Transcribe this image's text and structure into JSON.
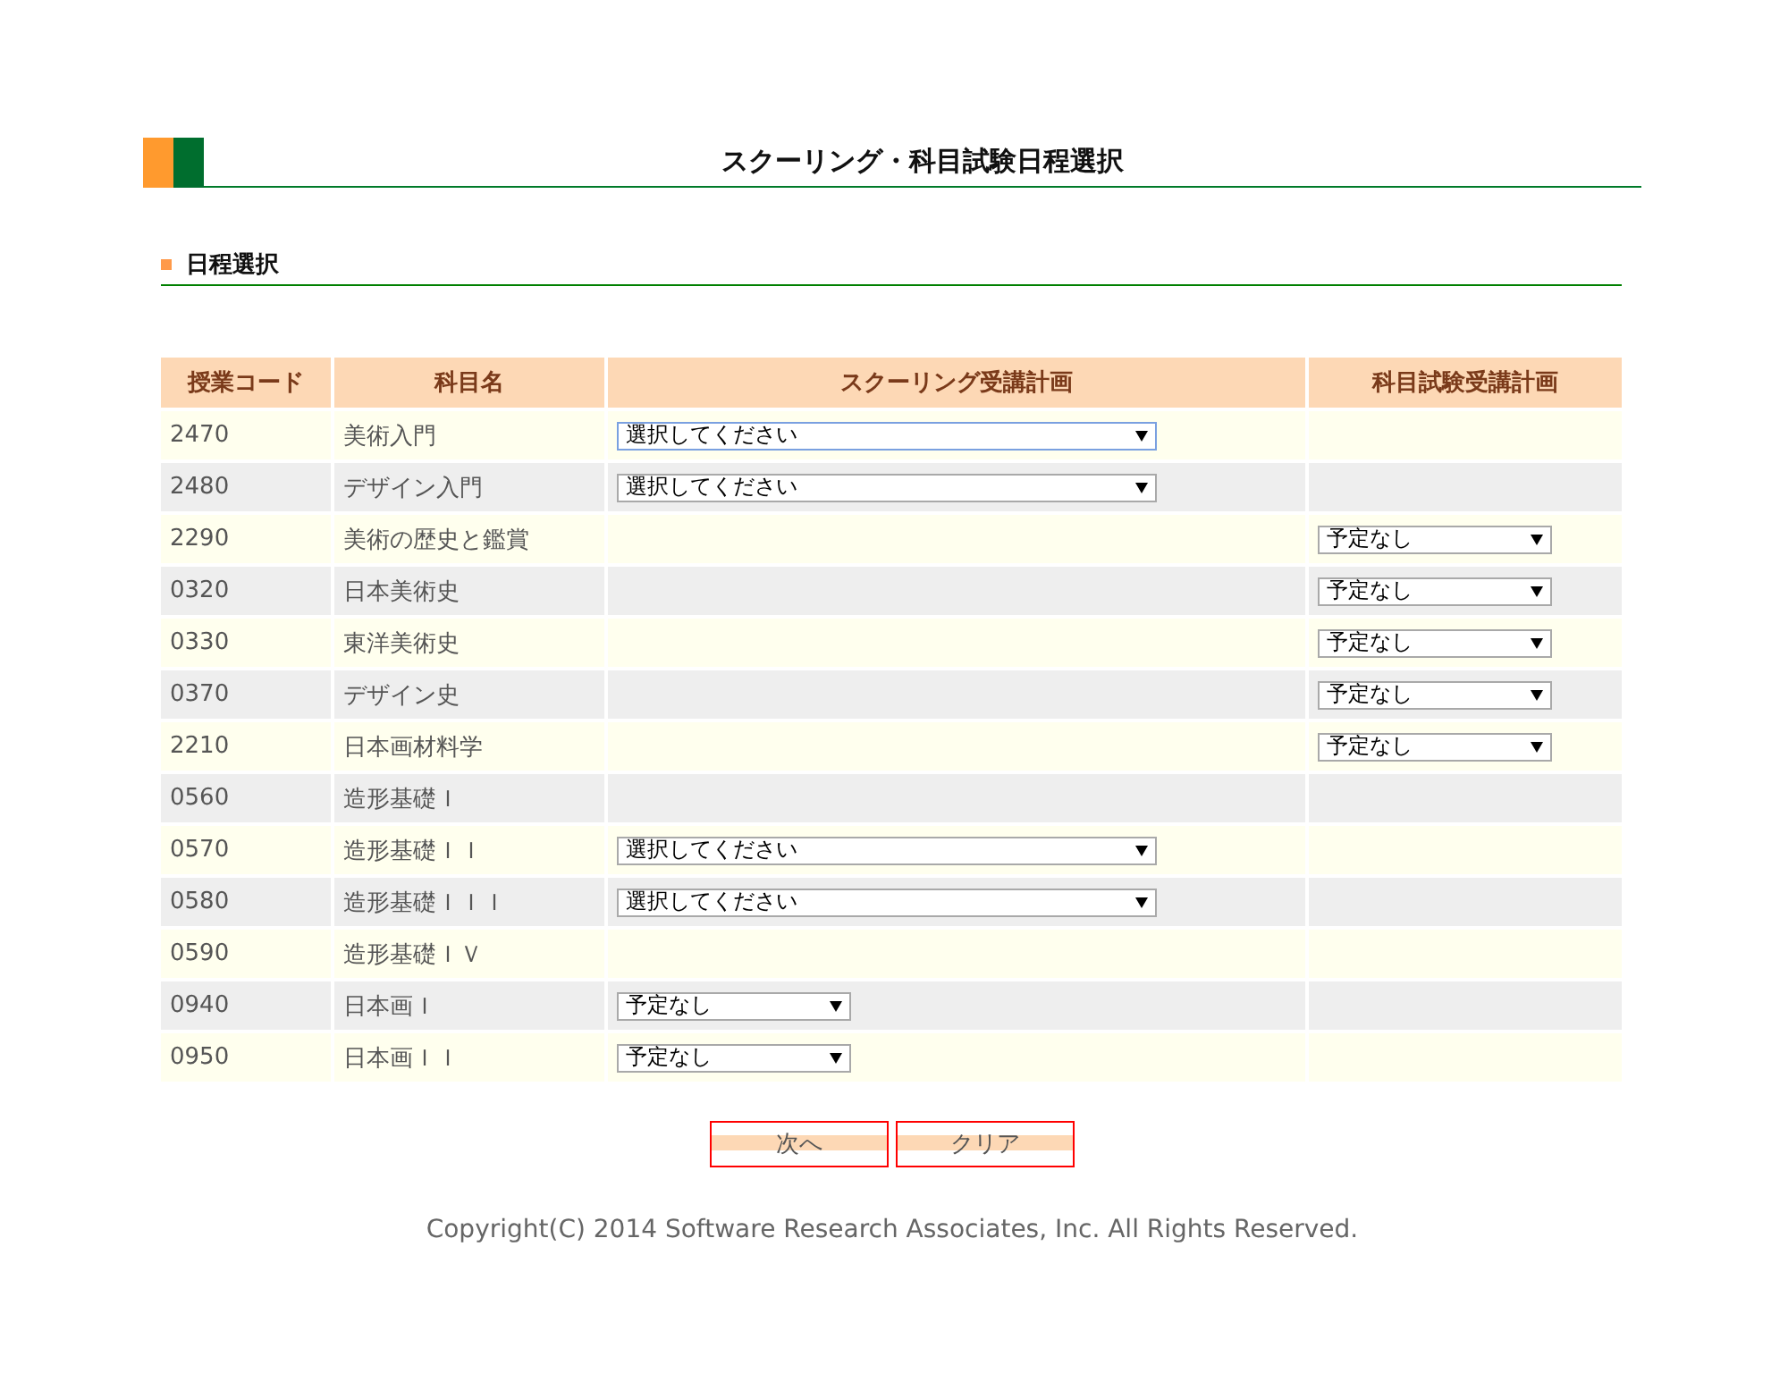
{
  "page_title": "スクーリング・科目試験日程選択",
  "section_title": "日程選択",
  "table": {
    "columns": [
      "授業コード",
      "科目名",
      "スクーリング受講計画",
      "科目試験受講計画"
    ],
    "rows": [
      {
        "code": "2470",
        "name": "美術入門",
        "schooling": {
          "kind": "wide",
          "value": "選択してください",
          "focused": true
        },
        "exam": null
      },
      {
        "code": "2480",
        "name": "デザイン入門",
        "schooling": {
          "kind": "wide",
          "value": "選択してください",
          "focused": false
        },
        "exam": null
      },
      {
        "code": "2290",
        "name": "美術の歴史と鑑賞",
        "schooling": null,
        "exam": {
          "kind": "narrow",
          "value": "予定なし",
          "focused": false
        }
      },
      {
        "code": "0320",
        "name": "日本美術史",
        "schooling": null,
        "exam": {
          "kind": "narrow",
          "value": "予定なし",
          "focused": false
        }
      },
      {
        "code": "0330",
        "name": "東洋美術史",
        "schooling": null,
        "exam": {
          "kind": "narrow",
          "value": "予定なし",
          "focused": false
        }
      },
      {
        "code": "0370",
        "name": "デザイン史",
        "schooling": null,
        "exam": {
          "kind": "narrow",
          "value": "予定なし",
          "focused": false
        }
      },
      {
        "code": "2210",
        "name": "日本画材料学",
        "schooling": null,
        "exam": {
          "kind": "narrow",
          "value": "予定なし",
          "focused": false
        }
      },
      {
        "code": "0560",
        "name": "造形基礎Ｉ",
        "schooling": null,
        "exam": null
      },
      {
        "code": "0570",
        "name": "造形基礎ＩＩ",
        "schooling": {
          "kind": "wide",
          "value": "選択してください",
          "focused": false
        },
        "exam": null
      },
      {
        "code": "0580",
        "name": "造形基礎ＩＩＩ",
        "schooling": {
          "kind": "wide",
          "value": "選択してください",
          "focused": false
        },
        "exam": null
      },
      {
        "code": "0590",
        "name": "造形基礎ＩＶ",
        "schooling": null,
        "exam": null
      },
      {
        "code": "0940",
        "name": "日本画Ｉ",
        "schooling": {
          "kind": "narrow",
          "value": "予定なし",
          "focused": false
        },
        "exam": null
      },
      {
        "code": "0950",
        "name": "日本画ＩＩ",
        "schooling": {
          "kind": "narrow",
          "value": "予定なし",
          "focused": false
        },
        "exam": null
      }
    ]
  },
  "buttons": [
    "次へ",
    "クリア"
  ],
  "copyright": "Copyright(C) 2014 Software Research Associates, Inc. All Rights Reserved."
}
